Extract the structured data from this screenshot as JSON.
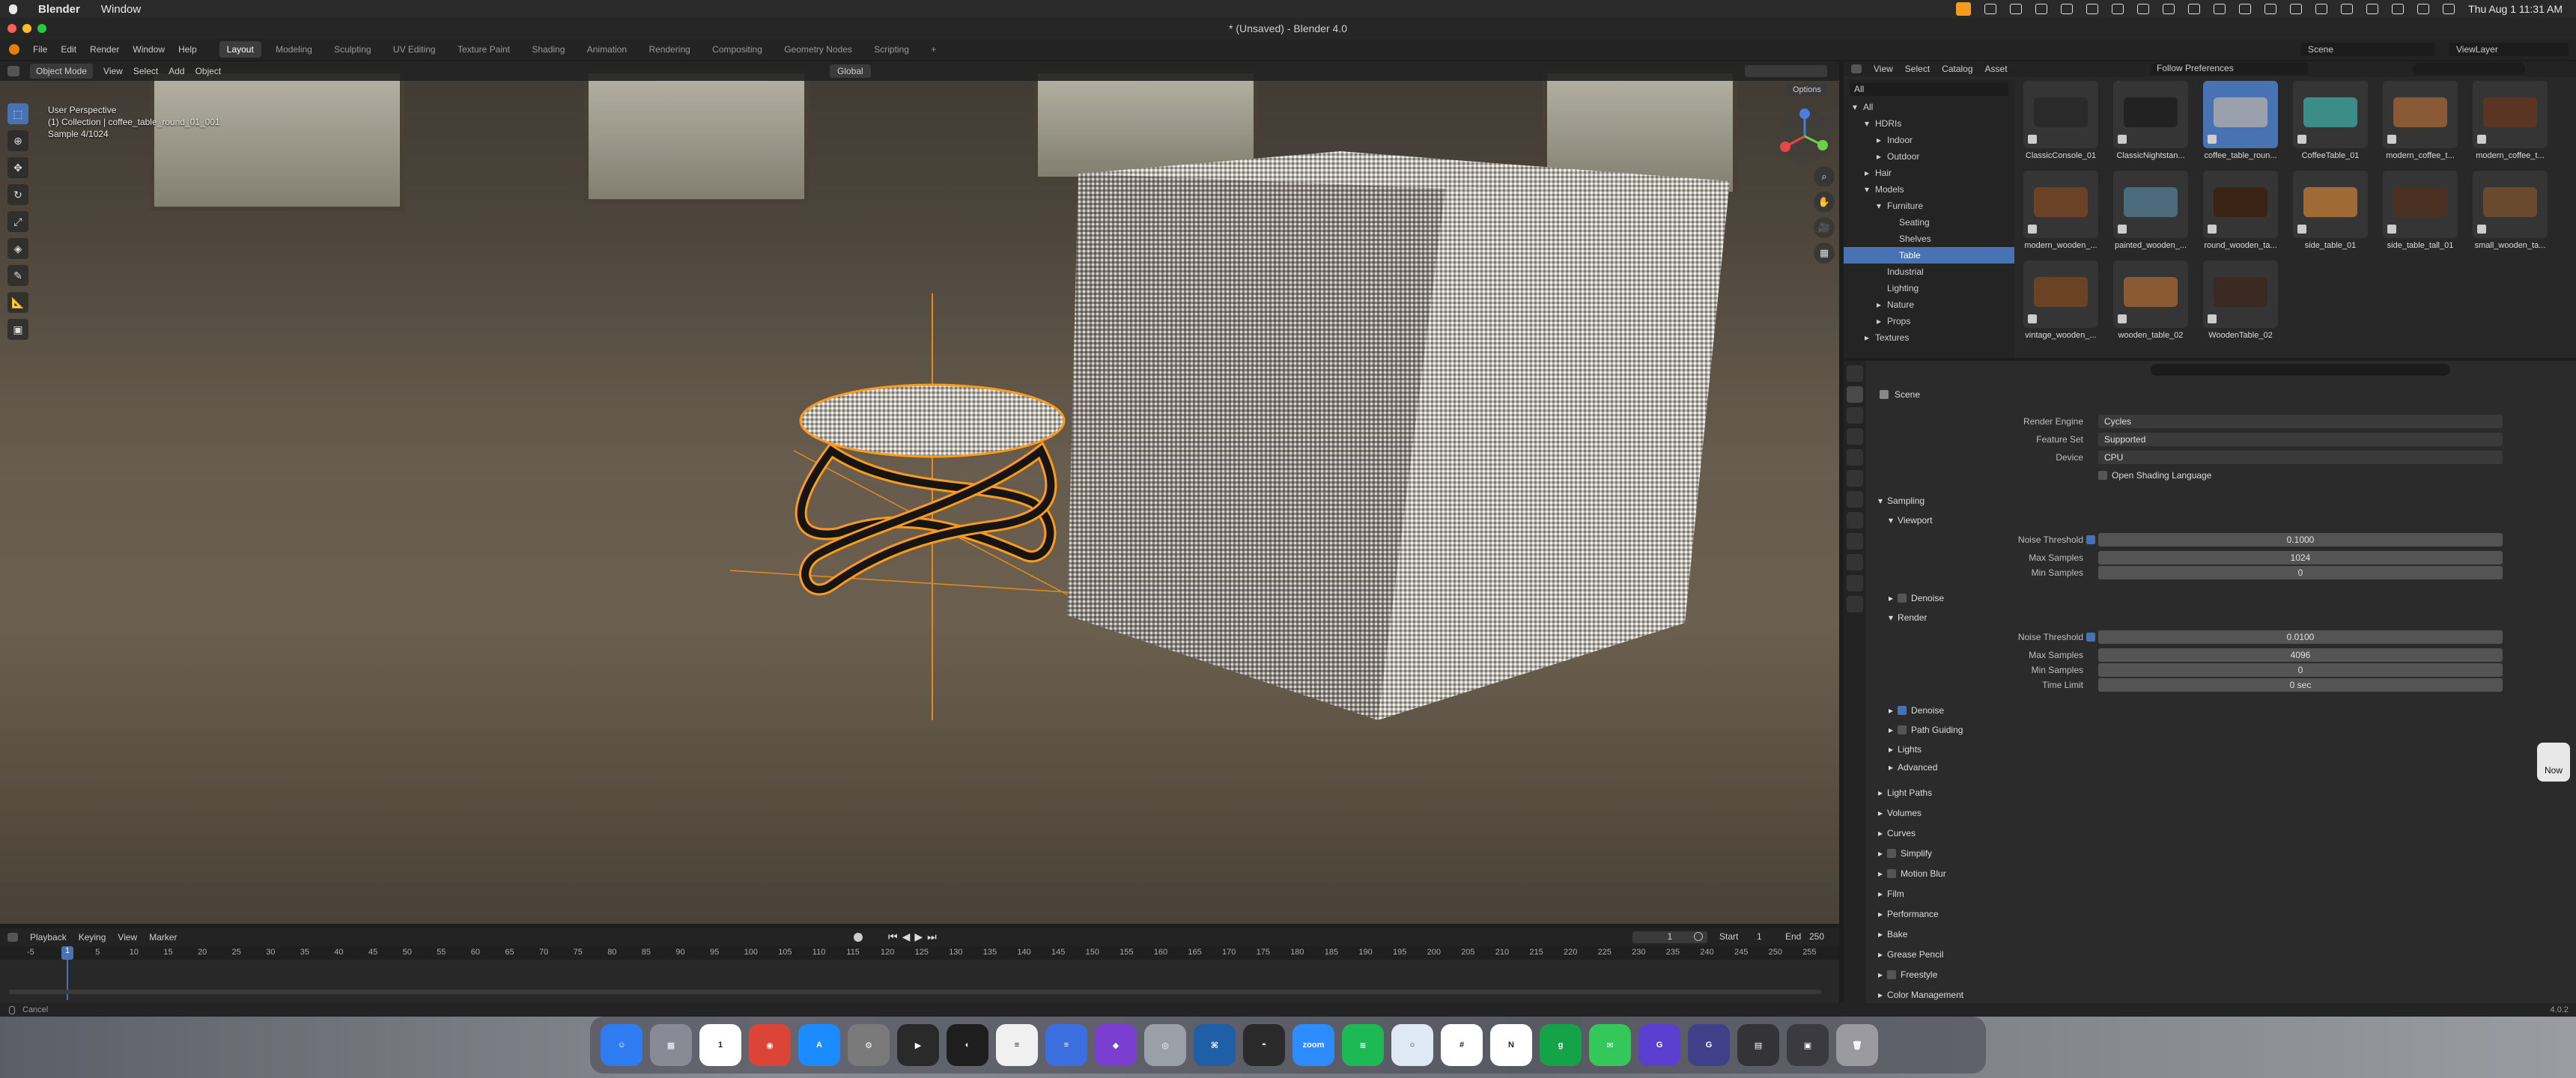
{
  "macos": {
    "app_name": "Blender",
    "menu": [
      "Window"
    ],
    "clock": "Thu Aug 1  11:31 AM"
  },
  "window": {
    "title": "* (Unsaved) - Blender 4.0"
  },
  "topbar": {
    "menus": [
      "File",
      "Edit",
      "Render",
      "Window",
      "Help"
    ],
    "workspaces": [
      "Layout",
      "Modeling",
      "Sculpting",
      "UV Editing",
      "Texture Paint",
      "Shading",
      "Animation",
      "Rendering",
      "Compositing",
      "Geometry Nodes",
      "Scripting"
    ],
    "active_workspace": "Layout",
    "scene_name": "Scene",
    "view_layer": "ViewLayer"
  },
  "viewport": {
    "mode": "Object Mode",
    "menus": [
      "View",
      "Select",
      "Add",
      "Object"
    ],
    "transform_orientation": "Global",
    "options_label": "Options",
    "overlay_lines": [
      "User Perspective",
      "(1) Collection | coffee_table_round_01_001",
      "Sample 4/1024"
    ]
  },
  "timeline": {
    "menus": [
      "Playback",
      "Keying",
      "View",
      "Marker"
    ],
    "current_frame": "1",
    "start_label": "Start",
    "start": "1",
    "end_label": "End",
    "end": "250",
    "ruler": [
      "-5",
      "1",
      "5",
      "10",
      "15",
      "20",
      "25",
      "30",
      "35",
      "40",
      "45",
      "50",
      "55",
      "60",
      "65",
      "70",
      "75",
      "80",
      "85",
      "90",
      "95",
      "100",
      "105",
      "110",
      "115",
      "120",
      "125",
      "130",
      "135",
      "140",
      "145",
      "150",
      "155",
      "160",
      "165",
      "170",
      "175",
      "180",
      "185",
      "190",
      "195",
      "200",
      "205",
      "210",
      "215",
      "220",
      "225",
      "230",
      "235",
      "240",
      "245",
      "250",
      "255"
    ]
  },
  "statusbar": {
    "left": "Cancel",
    "version": "4.0.2"
  },
  "asset_browser": {
    "menus": [
      "View",
      "Select",
      "Catalog",
      "Asset"
    ],
    "library": "Follow Preferences",
    "filter": "All",
    "tree": [
      {
        "label": "All",
        "indent": 0,
        "arrow": "▾"
      },
      {
        "label": "HDRIs",
        "indent": 1,
        "arrow": "▾"
      },
      {
        "label": "Indoor",
        "indent": 2,
        "arrow": "▸"
      },
      {
        "label": "Outdoor",
        "indent": 2,
        "arrow": "▸"
      },
      {
        "label": "Hair",
        "indent": 1,
        "arrow": "▸"
      },
      {
        "label": "Models",
        "indent": 1,
        "arrow": "▾"
      },
      {
        "label": "Furniture",
        "indent": 2,
        "arrow": "▾"
      },
      {
        "label": "Seating",
        "indent": 3,
        "arrow": ""
      },
      {
        "label": "Shelves",
        "indent": 3,
        "arrow": ""
      },
      {
        "label": "Table",
        "indent": 3,
        "arrow": "",
        "selected": true
      },
      {
        "label": "Industrial",
        "indent": 2,
        "arrow": ""
      },
      {
        "label": "Lighting",
        "indent": 2,
        "arrow": ""
      },
      {
        "label": "Nature",
        "indent": 2,
        "arrow": "▸"
      },
      {
        "label": "Props",
        "indent": 2,
        "arrow": "▸"
      },
      {
        "label": "Textures",
        "indent": 1,
        "arrow": "▸"
      }
    ],
    "assets": [
      {
        "name": "ClassicConsole_01",
        "color": "#2a2a2a"
      },
      {
        "name": "ClassicNightstan...",
        "color": "#222222"
      },
      {
        "name": "coffee_table_roun...",
        "color": "#9aa1ad",
        "selected": true
      },
      {
        "name": "CoffeeTable_01",
        "color": "#3c8d8a"
      },
      {
        "name": "modern_coffee_t...",
        "color": "#8a5a36"
      },
      {
        "name": "modern_coffee_t...",
        "color": "#5a3524"
      },
      {
        "name": "modern_wooden_...",
        "color": "#6b4226"
      },
      {
        "name": "painted_wooden_...",
        "color": "#4b6a7c"
      },
      {
        "name": "round_wooden_ta...",
        "color": "#3b2416"
      },
      {
        "name": "side_table_01",
        "color": "#a06a36"
      },
      {
        "name": "side_table_tall_01",
        "color": "#4a3020"
      },
      {
        "name": "small_wooden_ta...",
        "color": "#6a4a2e"
      },
      {
        "name": "vintage_wooden_...",
        "color": "#6a4224"
      },
      {
        "name": "wooden_table_02",
        "color": "#8a5a34"
      },
      {
        "name": "WoodenTable_02",
        "color": "#3a2a22"
      }
    ]
  },
  "properties": {
    "context": "Scene",
    "render_engine_label": "Render Engine",
    "render_engine": "Cycles",
    "feature_set_label": "Feature Set",
    "feature_set": "Supported",
    "device_label": "Device",
    "device": "CPU",
    "osl_label": "Open Shading Language",
    "sampling": "Sampling",
    "viewport": "Viewport",
    "noise_threshold_label": "Noise Threshold",
    "vp_noise_threshold": "0.1000",
    "max_samples_label": "Max Samples",
    "vp_max_samples": "1024",
    "min_samples_label": "Min Samples",
    "vp_min_samples": "0",
    "denoise_label": "Denoise",
    "render": "Render",
    "r_noise_threshold": "0.0100",
    "r_max_samples": "4096",
    "r_min_samples": "0",
    "time_limit_label": "Time Limit",
    "r_time_limit": "0 sec",
    "path_guiding": "Path Guiding",
    "lights": "Lights",
    "advanced": "Advanced",
    "panels": [
      "Light Paths",
      "Volumes",
      "Curves",
      "Simplify",
      "Motion Blur",
      "Film",
      "Performance",
      "Bake",
      "Grease Pencil",
      "Freestyle",
      "Color Management"
    ]
  },
  "notification": "Now",
  "dock": [
    {
      "name": "Finder",
      "color": "#2f7bf0",
      "glyph": "☺"
    },
    {
      "name": "Launchpad",
      "color": "#8a8a96",
      "glyph": "▦"
    },
    {
      "name": "Calendar",
      "color": "#ffffff",
      "glyph": "1"
    },
    {
      "name": "Chrome",
      "color": "#db4437",
      "glyph": "◉"
    },
    {
      "name": "App Store",
      "color": "#1a8cff",
      "glyph": "A"
    },
    {
      "name": "System Settings",
      "color": "#7a7a7a",
      "glyph": "⚙"
    },
    {
      "name": "Claquette",
      "color": "#2a2a2a",
      "glyph": "▶"
    },
    {
      "name": "Figma",
      "color": "#1e1e1e",
      "glyph": "◐"
    },
    {
      "name": "Docs",
      "color": "#f0f0f0",
      "glyph": "≡"
    },
    {
      "name": "Docs2",
      "color": "#3b6fe0",
      "glyph": "≡"
    },
    {
      "name": "Affinity",
      "color": "#7a3fd0",
      "glyph": "◆"
    },
    {
      "name": "Disk Utility",
      "color": "#9aa0a8",
      "glyph": "◎"
    },
    {
      "name": "VS Code",
      "color": "#1e5fa8",
      "glyph": "⌘"
    },
    {
      "name": "Blender",
      "color": "#2a2a2a",
      "glyph": "◓"
    },
    {
      "name": "Zoom",
      "color": "#2d8cff",
      "glyph": "zoom"
    },
    {
      "name": "Spotify",
      "color": "#1db954",
      "glyph": "≋"
    },
    {
      "name": "Circle",
      "color": "#dfe8f5",
      "glyph": "○"
    },
    {
      "name": "Slack",
      "color": "#ffffff",
      "glyph": "#"
    },
    {
      "name": "Notion",
      "color": "#ffffff",
      "glyph": "N"
    },
    {
      "name": "Grammarly",
      "color": "#15a34a",
      "glyph": "g"
    },
    {
      "name": "Messages",
      "color": "#34c759",
      "glyph": "✉"
    },
    {
      "name": "Gyroflow",
      "color": "#5b3fd0",
      "glyph": "G"
    },
    {
      "name": "Gyroflow2",
      "color": "#3f3f8a",
      "glyph": "G"
    },
    {
      "name": "Screenshots",
      "color": "#333338",
      "glyph": "▤"
    },
    {
      "name": "Folder",
      "color": "#3a3a40",
      "glyph": "▣"
    },
    {
      "name": "Trash",
      "color": "#9a9aa0",
      "glyph": "🗑"
    }
  ]
}
